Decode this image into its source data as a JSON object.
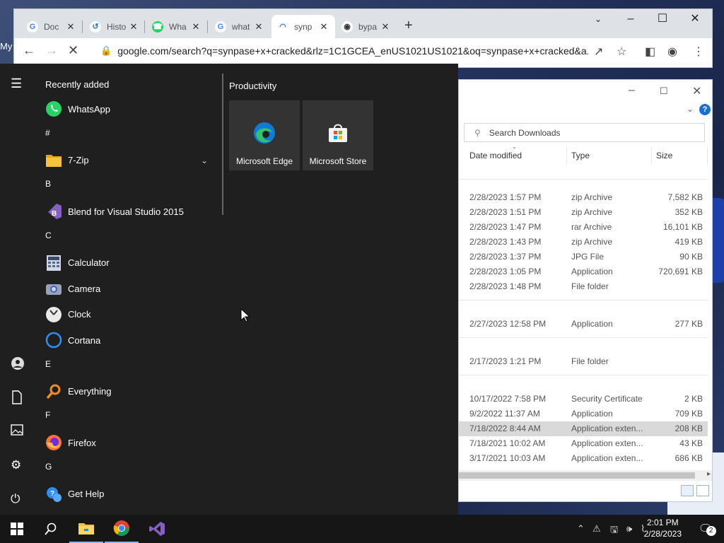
{
  "desktop": {
    "partial_label": "My"
  },
  "browser": {
    "tabs": [
      {
        "label": "Doc",
        "icon": "google-icon"
      },
      {
        "label": "Histo",
        "icon": "history-icon"
      },
      {
        "label": "Wha",
        "icon": "whatsapp-icon"
      },
      {
        "label": "what",
        "icon": "google-icon"
      },
      {
        "label": "synp",
        "icon": "loading-icon",
        "active": true
      },
      {
        "label": "bypa",
        "icon": "globe-icon"
      }
    ],
    "new_tab": "+",
    "url": "google.com/search?q=synpase+x+cracked&rlz=1C1GCEA_enUS1021US1021&oq=synpase+x+cracked&a..."
  },
  "start_menu": {
    "recently_added_label": "Recently added",
    "productivity_label": "Productivity",
    "apps": [
      {
        "type": "app",
        "label": "WhatsApp",
        "icon": "whatsapp-icon"
      },
      {
        "type": "header",
        "label": "#"
      },
      {
        "type": "app",
        "label": "7-Zip",
        "icon": "folder-icon",
        "expandable": true
      },
      {
        "type": "header",
        "label": "B"
      },
      {
        "type": "app",
        "label": "Blend for Visual Studio 2015",
        "icon": "blend-icon"
      },
      {
        "type": "header",
        "label": "C"
      },
      {
        "type": "app",
        "label": "Calculator",
        "icon": "calculator-icon"
      },
      {
        "type": "app",
        "label": "Camera",
        "icon": "camera-icon"
      },
      {
        "type": "app",
        "label": "Clock",
        "icon": "clock-icon"
      },
      {
        "type": "app",
        "label": "Cortana",
        "icon": "cortana-icon"
      },
      {
        "type": "header",
        "label": "E"
      },
      {
        "type": "app",
        "label": "Everything",
        "icon": "search-magnifier-icon"
      },
      {
        "type": "header",
        "label": "F"
      },
      {
        "type": "app",
        "label": "Firefox",
        "icon": "firefox-icon"
      },
      {
        "type": "header",
        "label": "G"
      },
      {
        "type": "app",
        "label": "Get Help",
        "icon": "help-icon"
      }
    ],
    "tiles": [
      {
        "label": "Microsoft Edge",
        "icon": "edge-icon"
      },
      {
        "label": "Microsoft Store",
        "icon": "store-icon"
      }
    ]
  },
  "explorer": {
    "search_placeholder": "Search Downloads",
    "columns": [
      "Date modified",
      "Type",
      "Size"
    ],
    "groups": [
      [
        {
          "date": "2/28/2023 1:57 PM",
          "type": "zip Archive",
          "size": "7,582 KB"
        },
        {
          "date": "2/28/2023 1:51 PM",
          "type": "zip Archive",
          "size": "352 KB"
        },
        {
          "date": "2/28/2023 1:47 PM",
          "type": "rar Archive",
          "size": "16,101 KB"
        },
        {
          "date": "2/28/2023 1:43 PM",
          "type": "zip Archive",
          "size": "419 KB"
        },
        {
          "date": "2/28/2023 1:37 PM",
          "type": "JPG File",
          "size": "90 KB"
        },
        {
          "date": "2/28/2023 1:05 PM",
          "type": "Application",
          "size": "720,691 KB"
        },
        {
          "date": "2/28/2023 1:48 PM",
          "type": "File folder",
          "size": ""
        }
      ],
      [
        {
          "date": "2/27/2023 12:58 PM",
          "type": "Application",
          "size": "277 KB"
        }
      ],
      [
        {
          "date": "2/17/2023 1:21 PM",
          "type": "File folder",
          "size": ""
        }
      ],
      [
        {
          "date": "10/17/2022 7:58 PM",
          "type": "Security Certificate",
          "size": "2 KB"
        },
        {
          "date": "9/2/2022 11:37 AM",
          "type": "Application",
          "size": "709 KB"
        },
        {
          "date": "7/18/2022 8:44 AM",
          "type": "Application exten...",
          "size": "208 KB",
          "selected": true
        },
        {
          "date": "7/18/2021 10:02 AM",
          "type": "Application exten...",
          "size": "43 KB"
        },
        {
          "date": "3/17/2021 10:03 AM",
          "type": "Application exten...",
          "size": "686 KB"
        }
      ]
    ]
  },
  "taskbar": {
    "time": "2:01 PM",
    "date": "2/28/2023",
    "notification_count": "2",
    "pinned": [
      "file-explorer-icon",
      "chrome-icon",
      "visual-studio-icon"
    ]
  }
}
